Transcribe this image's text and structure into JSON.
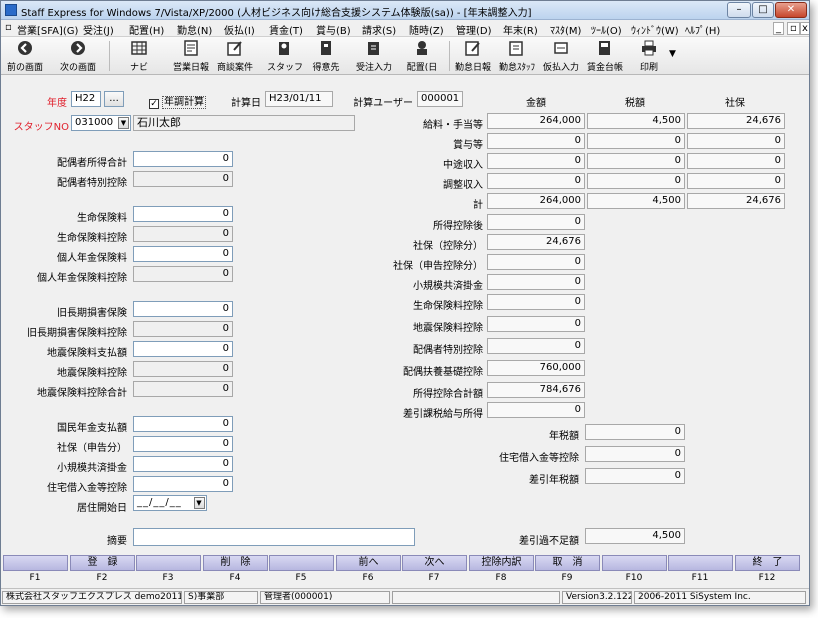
{
  "window": {
    "title": "Staff Express for Windows 7/Vista/XP/2000 (人材ビジネス向け総合支援システム体験版(sa)) - [年末調整入力]"
  },
  "menu": [
    "営業[SFA](G)",
    "受注(J)",
    "配置(H)",
    "勤怠(N)",
    "仮払(I)",
    "賃金(T)",
    "賞与(B)",
    "請求(S)",
    "随時(Z)",
    "管理(D)",
    "年末(R)",
    "ﾏｽﾀ(M)",
    "ﾂｰﾙ(O)",
    "ｳｨﾝﾄﾞｳ(W)",
    "ﾍﾙﾌﾟ(H)"
  ],
  "toolbar": [
    "前の画面",
    "次の画面",
    "ナビ",
    "営業日報",
    "商談案件",
    "スタッフ",
    "得意先",
    "受注入力",
    "配置(日",
    "勤怠日報",
    "勤怠ｽﾀｯﾌ",
    "仮払入力",
    "賃金台帳",
    "印刷"
  ],
  "header": {
    "nendo_label": "年度",
    "nendo_value": "H22",
    "nendo_btn": "...",
    "nencho_label": "年調計算",
    "calc_date_label": "計算日",
    "calc_date_value": "H23/01/11",
    "calc_user_label": "計算ユーザー",
    "calc_user_value": "000001",
    "staff_label": "スタッフNO",
    "staff_no": "031000",
    "staff_name": "石川太郎"
  },
  "columns": {
    "amount": "金額",
    "tax": "税額",
    "social": "社保"
  },
  "income_rows": [
    {
      "label": "給料・手当等",
      "amount": "264,000",
      "tax": "4,500",
      "social": "24,676"
    },
    {
      "label": "賞与等",
      "amount": "0",
      "tax": "0",
      "social": "0"
    },
    {
      "label": "中途収入",
      "amount": "0",
      "tax": "0",
      "social": "0"
    },
    {
      "label": "調整収入",
      "amount": "0",
      "tax": "0",
      "social": "0"
    },
    {
      "label": "計",
      "amount": "264,000",
      "tax": "4,500",
      "social": "24,676"
    }
  ],
  "left_fields": [
    {
      "label": "配偶者所得合計",
      "value": "0"
    },
    {
      "label": "配偶者特別控除",
      "value": "0"
    },
    {
      "label": "生命保険料",
      "value": "0"
    },
    {
      "label": "生命保険料控除",
      "value": "0"
    },
    {
      "label": "個人年金保険料",
      "value": "0"
    },
    {
      "label": "個人年金保険料控除",
      "value": "0"
    },
    {
      "label": "旧長期損害保険",
      "value": "0"
    },
    {
      "label": "旧長期損害保険料控除",
      "value": "0"
    },
    {
      "label": "地震保険料支払額",
      "value": "0"
    },
    {
      "label": "地震保険料控除",
      "value": "0"
    },
    {
      "label": "地震保険料控除合計",
      "value": "0"
    },
    {
      "label": "国民年金支払額",
      "value": "0"
    },
    {
      "label": "社保（申告分）",
      "value": "0"
    },
    {
      "label": "小規模共済掛金",
      "value": "0"
    },
    {
      "label": "住宅借入金等控除",
      "value": "0"
    }
  ],
  "residence_start": {
    "label": "居住開始日",
    "value": "__/__/__"
  },
  "middle_fields": [
    {
      "label": "所得控除後",
      "value": "0"
    },
    {
      "label": "社保（控除分）",
      "value": "24,676"
    },
    {
      "label": "社保（申告控除分）",
      "value": "0"
    },
    {
      "label": "小規模共済掛金",
      "value": "0"
    },
    {
      "label": "生命保険料控除",
      "value": "0"
    },
    {
      "label": "地震保険料控除",
      "value": "0"
    },
    {
      "label": "配偶者特別控除",
      "value": "0"
    },
    {
      "label": "配偶扶養基礎控除",
      "value": "760,000"
    },
    {
      "label": "所得控除合計額",
      "value": "784,676"
    },
    {
      "label": "差引課税給与所得",
      "value": "0"
    }
  ],
  "right_fields": [
    {
      "label": "年税額",
      "value": "0"
    },
    {
      "label": "住宅借入金等控除",
      "value": "0"
    },
    {
      "label": "差引年税額",
      "value": "0"
    }
  ],
  "memo_label": "摘要",
  "shortage": {
    "label": "差引過不足額",
    "value": "4,500"
  },
  "fkeys": [
    {
      "key": "F1",
      "label": ""
    },
    {
      "key": "F2",
      "label": "登　録"
    },
    {
      "key": "F3",
      "label": ""
    },
    {
      "key": "F4",
      "label": "削　除"
    },
    {
      "key": "F5",
      "label": ""
    },
    {
      "key": "F6",
      "label": "前へ"
    },
    {
      "key": "F7",
      "label": "次へ"
    },
    {
      "key": "F8",
      "label": "控除内訳"
    },
    {
      "key": "F9",
      "label": "取　消"
    },
    {
      "key": "F10",
      "label": ""
    },
    {
      "key": "F11",
      "label": ""
    },
    {
      "key": "F12",
      "label": "終　了"
    }
  ],
  "status": [
    "株式会社スタッフエクスプレス demo201101",
    "S)事業部",
    "管理者(000001)",
    "",
    "Version3.2.122",
    "2006-2011 SiSystem Inc."
  ],
  "colors": {
    "accent_red": "#e0202c",
    "fkey": "#c6c6ea"
  }
}
